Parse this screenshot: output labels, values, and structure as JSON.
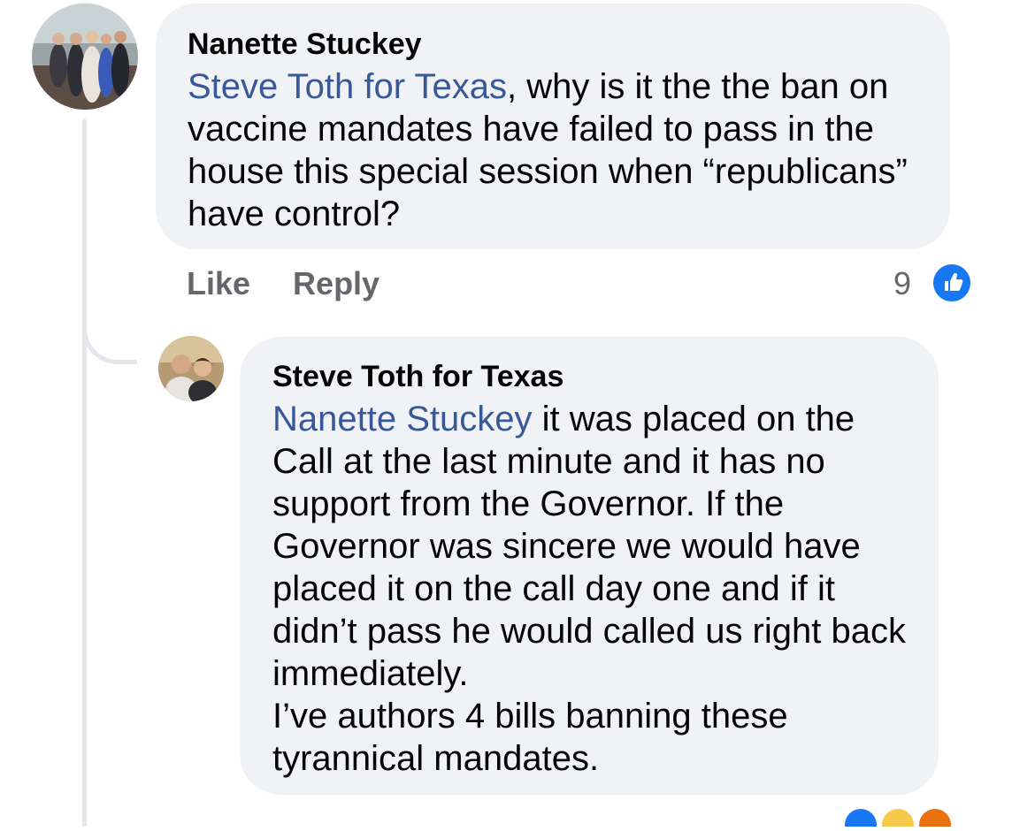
{
  "comment": {
    "author": "Nanette Stuckey",
    "mention": "Steve Toth for Texas",
    "text": ", why is it the the ban on vaccine mandates have failed to pass in the house this special session when “republicans” have control?",
    "actions": {
      "like": "Like",
      "reply": "Reply"
    },
    "reaction_count": "9",
    "reaction_icon": "thumbs-up-icon"
  },
  "reply": {
    "author": "Steve Toth for Texas",
    "mention": "Nanette Stuckey",
    "text_lines": [
      " it was placed on the Call at the last minute and it has no support from the Governor. If the Governor was sincere we would have placed it on the call day one and if it didn’t pass he would called us right back immediately.",
      "I’ve authors 4 bills banning these tyrannical mandates."
    ]
  },
  "colors": {
    "mention": "#385898",
    "bubble": "#f0f2f5",
    "like_blue": "#1877f2",
    "meta_gray": "#65676b"
  }
}
